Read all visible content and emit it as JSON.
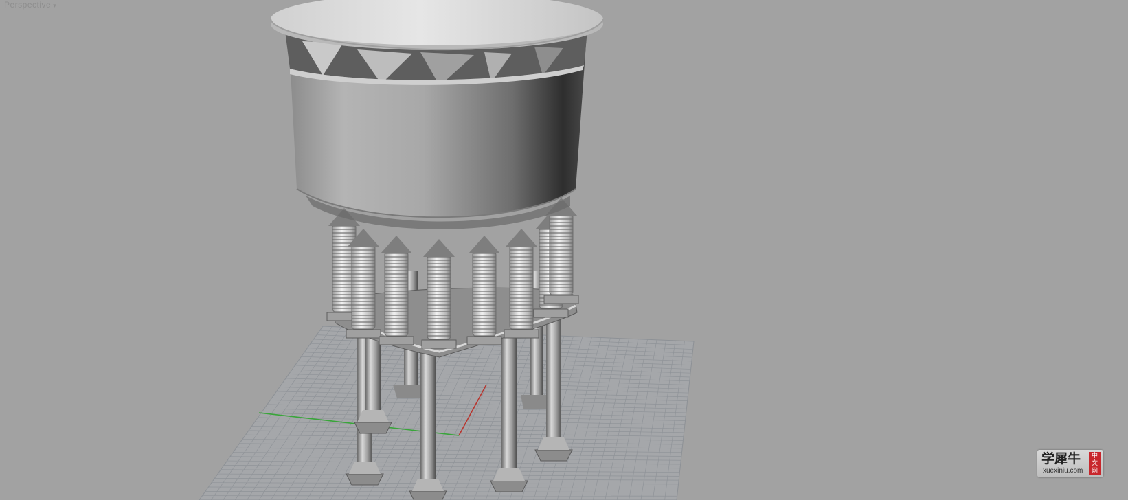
{
  "viewport": {
    "label": "Perspective",
    "label_arrow": "▾",
    "background": "#a2a2a2"
  },
  "scene": {
    "object": "water-tower-model",
    "grid_color": "#8d9196",
    "axis_x_color": "#b8352e",
    "axis_y_color": "#39a53a",
    "columns": 8
  },
  "watermark": {
    "main_text": "学犀牛",
    "url_text": "xuexiniu.com",
    "badge_chars": [
      "中",
      "文",
      "网"
    ]
  }
}
